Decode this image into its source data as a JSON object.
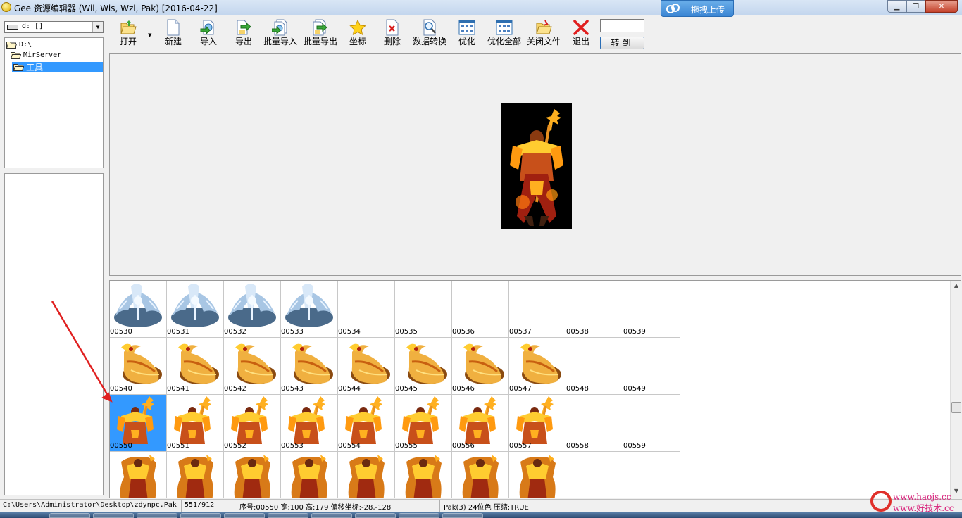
{
  "window": {
    "title": "Gee 资源编辑器 (Wil, Wis, Wzl, Pak) [2016-04-22]",
    "upload_label": "拖拽上传",
    "controls": {
      "minimize": "▁",
      "maximize": "❐",
      "close": "✕"
    }
  },
  "drive": {
    "value": "d: []"
  },
  "tree": [
    {
      "label": "D:\\",
      "selected": false
    },
    {
      "label": "MirServer",
      "selected": false
    },
    {
      "label": "工具",
      "selected": true
    }
  ],
  "toolbar": [
    {
      "id": "open",
      "label": "打开",
      "icon": "folder-open-icon"
    },
    {
      "id": "new",
      "label": "新建",
      "icon": "new-file-icon"
    },
    {
      "id": "import",
      "label": "导入",
      "icon": "import-icon"
    },
    {
      "id": "export",
      "label": "导出",
      "icon": "export-icon"
    },
    {
      "id": "batch-import",
      "label": "批量导入",
      "icon": "batch-import-icon"
    },
    {
      "id": "batch-export",
      "label": "批量导出",
      "icon": "batch-export-icon"
    },
    {
      "id": "coords",
      "label": "坐标",
      "icon": "star-icon"
    },
    {
      "id": "delete",
      "label": "删除",
      "icon": "delete-icon"
    },
    {
      "id": "convert",
      "label": "数据转换",
      "icon": "magnifier-icon"
    },
    {
      "id": "optimize",
      "label": "优化",
      "icon": "grid-icon"
    },
    {
      "id": "optimize-all",
      "label": "优化全部",
      "icon": "grid-icon"
    },
    {
      "id": "close-file",
      "label": "关闭文件",
      "icon": "close-folder-icon"
    },
    {
      "id": "exit",
      "label": "退出",
      "icon": "red-x-icon"
    }
  ],
  "goto": {
    "input_value": "",
    "button_label": "转到"
  },
  "grid": {
    "rows": [
      {
        "kind": "ice",
        "cells": [
          "00530",
          "00531",
          "00532",
          "00533",
          "00534",
          "00535",
          "00536",
          "00537",
          "00538",
          "00539"
        ],
        "filled": 4
      },
      {
        "kind": "dragon",
        "cells": [
          "00540",
          "00541",
          "00542",
          "00543",
          "00544",
          "00545",
          "00546",
          "00547",
          "00548",
          "00549"
        ],
        "filled": 8
      },
      {
        "kind": "warrior",
        "cells": [
          "00550",
          "00551",
          "00552",
          "00553",
          "00554",
          "00555",
          "00556",
          "00557",
          "00558",
          "00559"
        ],
        "filled": 8
      },
      {
        "kind": "warrior2",
        "cells": [
          "",
          "",
          "",
          "",
          "",
          "",
          "",
          "",
          "",
          ""
        ],
        "filled": 8
      }
    ],
    "selected": "00550"
  },
  "status": {
    "path": "C:\\Users\\Administrator\\Desktop\\zdynpc.Pak",
    "count": "551/912",
    "info": "序号:00550 宽:100 高:179 偏移坐标:-28,-128",
    "format": "Pak(3) 24位色 压缩:TRUE"
  },
  "watermark": {
    "line1": "www.haojs.cc",
    "line2": "www.好技术.cc"
  },
  "colors": {
    "selection": "#3399ff",
    "title_bar": "#c3d6ee",
    "arrow": "#e02020"
  }
}
